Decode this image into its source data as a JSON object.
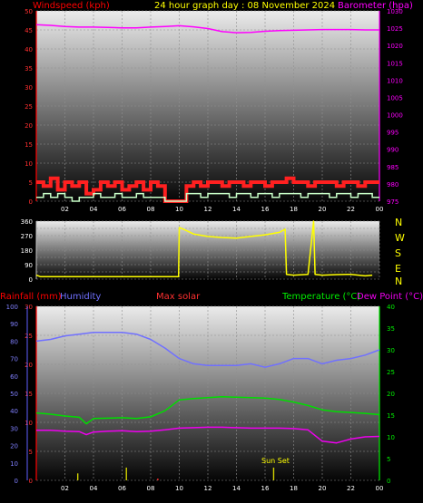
{
  "header": {
    "left_label": "Windspeed (kph)",
    "center_title": "24 hour graph day : 08 November 2024",
    "right_label": "Barometer (hpa)"
  },
  "compass_letters": [
    "N",
    "W",
    "S",
    "E",
    "N"
  ],
  "bottom_labels": {
    "rainfall": "Rainfall (mm)",
    "humidity": "Humidity",
    "max_solar": "Max solar",
    "temperature": "Temperature (°C)",
    "dew_point": "Dew Point (°C)",
    "sun_set": "Sun Set"
  },
  "colors": {
    "wind": "#ff0000",
    "gust": "#ff2020",
    "wind_avg": "#c8ffc8",
    "barometer": "#ff00ff",
    "direction": "#ffff00",
    "humidity": "#7070ff",
    "temperature": "#00dd00",
    "dew_point": "#ee00ee",
    "rain": "#d0d000",
    "solar": "#ff3030"
  },
  "chart_data": [
    {
      "type": "line",
      "title": "24 hour graph day : 08 November 2024",
      "x_ticks": [
        "02",
        "04",
        "06",
        "08",
        "10",
        "12",
        "14",
        "16",
        "18",
        "20",
        "22",
        "00"
      ],
      "left_axis": {
        "label": "Windspeed (kph)",
        "range": [
          0,
          50
        ],
        "ticks": [
          0,
          5,
          10,
          15,
          20,
          25,
          30,
          35,
          40,
          45,
          50
        ]
      },
      "right_axis": {
        "label": "Barometer (hpa)",
        "range": [
          975,
          1030
        ],
        "ticks": [
          975,
          980,
          985,
          990,
          995,
          1000,
          1005,
          1010,
          1015,
          1020,
          1025,
          1030
        ]
      },
      "series": [
        {
          "name": "Barometer (hpa)",
          "axis": "right",
          "x": [
            0,
            1,
            2,
            3,
            4,
            5,
            6,
            7,
            8,
            9,
            10,
            11,
            12,
            13,
            14,
            15,
            16,
            17,
            18,
            19,
            20,
            21,
            22,
            23,
            24
          ],
          "values": [
            1026.0,
            1025.8,
            1025.5,
            1025.3,
            1025.3,
            1025.2,
            1025.1,
            1025.1,
            1025.3,
            1025.5,
            1025.7,
            1025.4,
            1024.9,
            1024.0,
            1023.7,
            1023.8,
            1024.1,
            1024.3,
            1024.4,
            1024.5,
            1024.6,
            1024.6,
            1024.6,
            1024.5,
            1024.5
          ]
        },
        {
          "name": "Gust",
          "axis": "left",
          "x": [
            0,
            0.5,
            1,
            1.5,
            2,
            2.5,
            3,
            3.5,
            4,
            4.5,
            5,
            5.5,
            6,
            6.5,
            7,
            7.5,
            8,
            8.5,
            9,
            9.5,
            10,
            10.5,
            11,
            11.5,
            12,
            12.5,
            13,
            13.5,
            14,
            14.5,
            15,
            15.5,
            16,
            16.5,
            17,
            17.5,
            18,
            18.5,
            19,
            19.5,
            20,
            20.5,
            21,
            21.5,
            22,
            22.5,
            23,
            23.5
          ],
          "values": [
            5,
            4,
            6,
            3,
            5,
            4,
            5,
            2,
            3,
            5,
            4,
            5,
            3,
            4,
            5,
            3,
            5,
            4,
            0,
            0,
            0,
            4,
            5,
            4,
            5,
            5,
            4,
            5,
            5,
            4,
            5,
            5,
            4,
            5,
            5,
            6,
            5,
            5,
            4,
            5,
            5,
            5,
            4,
            5,
            5,
            4,
            5,
            5
          ]
        },
        {
          "name": "Wind speed",
          "axis": "left",
          "x": [
            0,
            0.5,
            1,
            1.5,
            2,
            2.5,
            3,
            3.5,
            4,
            4.5,
            5,
            5.5,
            6,
            6.5,
            7,
            7.5,
            8,
            8.5,
            9,
            9.5,
            10,
            10.5,
            11,
            11.5,
            12,
            12.5,
            13,
            13.5,
            14,
            14.5,
            15,
            15.5,
            16,
            16.5,
            17,
            17.5,
            18,
            18.5,
            19,
            19.5,
            20,
            20.5,
            21,
            21.5,
            22,
            22.5,
            23,
            23.5
          ],
          "values": [
            1,
            2,
            1,
            2,
            1,
            0,
            1,
            1,
            2,
            1,
            1,
            2,
            1,
            1,
            2,
            1,
            1,
            1,
            0,
            0,
            0,
            2,
            2,
            1,
            2,
            2,
            2,
            1,
            2,
            2,
            1,
            2,
            2,
            1,
            2,
            2,
            2,
            1,
            2,
            2,
            2,
            1,
            2,
            2,
            1,
            2,
            2,
            1
          ]
        }
      ]
    },
    {
      "type": "line",
      "x_ticks": [],
      "left_axis": {
        "label": "",
        "range": [
          0,
          360
        ],
        "ticks": [
          0,
          45,
          90,
          135,
          180,
          225,
          270,
          315,
          360
        ]
      },
      "series": [
        {
          "name": "Wind direction",
          "axis": "left",
          "x": [
            0,
            0.3,
            1,
            2,
            3,
            4,
            5,
            6,
            7,
            8,
            9,
            9.95,
            10,
            10.3,
            11,
            12,
            13,
            14,
            15,
            16,
            17,
            17.4,
            17.5,
            18,
            19,
            19.4,
            19.5,
            20,
            21,
            22,
            23,
            23.5
          ],
          "values": [
            25,
            15,
            15,
            15,
            15,
            15,
            15,
            15,
            15,
            15,
            15,
            15,
            320,
            310,
            280,
            265,
            258,
            255,
            265,
            275,
            290,
            310,
            30,
            25,
            30,
            360,
            30,
            25,
            28,
            30,
            20,
            25
          ]
        }
      ]
    },
    {
      "type": "line",
      "x_ticks": [
        "02",
        "04",
        "06",
        "08",
        "10",
        "12",
        "14",
        "16",
        "18",
        "20",
        "22",
        "00"
      ],
      "left_axis": {
        "label": "Rainfall (mm)",
        "range": [
          0,
          30
        ],
        "ticks": [
          0,
          5,
          10,
          15,
          20,
          25,
          30
        ]
      },
      "humidity_axis": {
        "label": "Humidity",
        "range": [
          0,
          100
        ],
        "ticks": [
          0,
          10,
          20,
          30,
          40,
          50,
          60,
          70,
          80,
          90,
          100
        ]
      },
      "right_axis": {
        "label": "Temperature (°C)",
        "range": [
          0,
          40
        ],
        "ticks": [
          0,
          5,
          10,
          15,
          20,
          25,
          30,
          35,
          40
        ]
      },
      "series": [
        {
          "name": "Humidity",
          "axis": "humidity",
          "x": [
            0,
            1,
            2,
            3,
            4,
            5,
            6,
            7,
            8,
            9,
            10,
            11,
            12,
            13,
            14,
            15,
            16,
            17,
            18,
            19,
            20,
            21,
            22,
            23,
            24
          ],
          "values": [
            80,
            81,
            83,
            84,
            85,
            85,
            85,
            84,
            81,
            76,
            70,
            67,
            66,
            66,
            66,
            67,
            65,
            67,
            70,
            70,
            67,
            69,
            70,
            72,
            75
          ]
        },
        {
          "name": "Temperature (°C)",
          "axis": "right",
          "x": [
            0,
            1,
            2,
            3,
            3.5,
            4,
            5,
            6,
            7,
            8,
            9,
            10,
            11,
            12,
            13,
            14,
            15,
            16,
            17,
            18,
            19,
            20,
            21,
            22,
            23,
            24
          ],
          "values": [
            15.5,
            15.2,
            14.8,
            14.5,
            13.0,
            14.2,
            14.3,
            14.4,
            14.2,
            14.6,
            16.0,
            18.5,
            18.8,
            19.0,
            19.2,
            19.1,
            19.0,
            18.9,
            18.6,
            18.0,
            17.2,
            16.2,
            15.8,
            15.6,
            15.4,
            15.1
          ]
        },
        {
          "name": "Dew Point (°C)",
          "axis": "right",
          "x": [
            0,
            1,
            2,
            3,
            3.5,
            4,
            5,
            6,
            7,
            8,
            9,
            10,
            11,
            12,
            13,
            14,
            15,
            16,
            17,
            18,
            19,
            20,
            21,
            22,
            23,
            24
          ],
          "values": [
            11.5,
            11.5,
            11.3,
            11.2,
            10.5,
            11.1,
            11.3,
            11.4,
            11.2,
            11.3,
            11.6,
            12.0,
            12.1,
            12.2,
            12.2,
            12.1,
            12.0,
            12.0,
            12.0,
            11.9,
            11.6,
            9.0,
            8.6,
            9.5,
            10.0,
            10.1
          ]
        },
        {
          "name": "Rainfall (mm)",
          "axis": "left",
          "x": [
            2.9,
            6.3
          ],
          "values": [
            1.2,
            2.2
          ]
        },
        {
          "name": "Max solar",
          "axis": "left",
          "x": [
            8.5
          ],
          "values": [
            0.3
          ]
        },
        {
          "name": "Sun Set",
          "axis": "left",
          "x": [
            16.6
          ],
          "values": [
            2.2
          ]
        }
      ]
    }
  ]
}
